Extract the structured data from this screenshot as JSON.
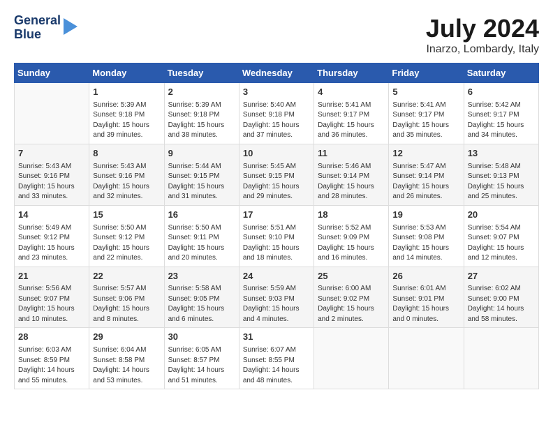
{
  "logo": {
    "line1": "General",
    "line2": "Blue"
  },
  "title": "July 2024",
  "subtitle": "Inarzo, Lombardy, Italy",
  "weekdays": [
    "Sunday",
    "Monday",
    "Tuesday",
    "Wednesday",
    "Thursday",
    "Friday",
    "Saturday"
  ],
  "weeks": [
    [
      {
        "day": "",
        "info": ""
      },
      {
        "day": "1",
        "info": "Sunrise: 5:39 AM\nSunset: 9:18 PM\nDaylight: 15 hours\nand 39 minutes."
      },
      {
        "day": "2",
        "info": "Sunrise: 5:39 AM\nSunset: 9:18 PM\nDaylight: 15 hours\nand 38 minutes."
      },
      {
        "day": "3",
        "info": "Sunrise: 5:40 AM\nSunset: 9:18 PM\nDaylight: 15 hours\nand 37 minutes."
      },
      {
        "day": "4",
        "info": "Sunrise: 5:41 AM\nSunset: 9:17 PM\nDaylight: 15 hours\nand 36 minutes."
      },
      {
        "day": "5",
        "info": "Sunrise: 5:41 AM\nSunset: 9:17 PM\nDaylight: 15 hours\nand 35 minutes."
      },
      {
        "day": "6",
        "info": "Sunrise: 5:42 AM\nSunset: 9:17 PM\nDaylight: 15 hours\nand 34 minutes."
      }
    ],
    [
      {
        "day": "7",
        "info": "Sunrise: 5:43 AM\nSunset: 9:16 PM\nDaylight: 15 hours\nand 33 minutes."
      },
      {
        "day": "8",
        "info": "Sunrise: 5:43 AM\nSunset: 9:16 PM\nDaylight: 15 hours\nand 32 minutes."
      },
      {
        "day": "9",
        "info": "Sunrise: 5:44 AM\nSunset: 9:15 PM\nDaylight: 15 hours\nand 31 minutes."
      },
      {
        "day": "10",
        "info": "Sunrise: 5:45 AM\nSunset: 9:15 PM\nDaylight: 15 hours\nand 29 minutes."
      },
      {
        "day": "11",
        "info": "Sunrise: 5:46 AM\nSunset: 9:14 PM\nDaylight: 15 hours\nand 28 minutes."
      },
      {
        "day": "12",
        "info": "Sunrise: 5:47 AM\nSunset: 9:14 PM\nDaylight: 15 hours\nand 26 minutes."
      },
      {
        "day": "13",
        "info": "Sunrise: 5:48 AM\nSunset: 9:13 PM\nDaylight: 15 hours\nand 25 minutes."
      }
    ],
    [
      {
        "day": "14",
        "info": "Sunrise: 5:49 AM\nSunset: 9:12 PM\nDaylight: 15 hours\nand 23 minutes."
      },
      {
        "day": "15",
        "info": "Sunrise: 5:50 AM\nSunset: 9:12 PM\nDaylight: 15 hours\nand 22 minutes."
      },
      {
        "day": "16",
        "info": "Sunrise: 5:50 AM\nSunset: 9:11 PM\nDaylight: 15 hours\nand 20 minutes."
      },
      {
        "day": "17",
        "info": "Sunrise: 5:51 AM\nSunset: 9:10 PM\nDaylight: 15 hours\nand 18 minutes."
      },
      {
        "day": "18",
        "info": "Sunrise: 5:52 AM\nSunset: 9:09 PM\nDaylight: 15 hours\nand 16 minutes."
      },
      {
        "day": "19",
        "info": "Sunrise: 5:53 AM\nSunset: 9:08 PM\nDaylight: 15 hours\nand 14 minutes."
      },
      {
        "day": "20",
        "info": "Sunrise: 5:54 AM\nSunset: 9:07 PM\nDaylight: 15 hours\nand 12 minutes."
      }
    ],
    [
      {
        "day": "21",
        "info": "Sunrise: 5:56 AM\nSunset: 9:07 PM\nDaylight: 15 hours\nand 10 minutes."
      },
      {
        "day": "22",
        "info": "Sunrise: 5:57 AM\nSunset: 9:06 PM\nDaylight: 15 hours\nand 8 minutes."
      },
      {
        "day": "23",
        "info": "Sunrise: 5:58 AM\nSunset: 9:05 PM\nDaylight: 15 hours\nand 6 minutes."
      },
      {
        "day": "24",
        "info": "Sunrise: 5:59 AM\nSunset: 9:03 PM\nDaylight: 15 hours\nand 4 minutes."
      },
      {
        "day": "25",
        "info": "Sunrise: 6:00 AM\nSunset: 9:02 PM\nDaylight: 15 hours\nand 2 minutes."
      },
      {
        "day": "26",
        "info": "Sunrise: 6:01 AM\nSunset: 9:01 PM\nDaylight: 15 hours\nand 0 minutes."
      },
      {
        "day": "27",
        "info": "Sunrise: 6:02 AM\nSunset: 9:00 PM\nDaylight: 14 hours\nand 58 minutes."
      }
    ],
    [
      {
        "day": "28",
        "info": "Sunrise: 6:03 AM\nSunset: 8:59 PM\nDaylight: 14 hours\nand 55 minutes."
      },
      {
        "day": "29",
        "info": "Sunrise: 6:04 AM\nSunset: 8:58 PM\nDaylight: 14 hours\nand 53 minutes."
      },
      {
        "day": "30",
        "info": "Sunrise: 6:05 AM\nSunset: 8:57 PM\nDaylight: 14 hours\nand 51 minutes."
      },
      {
        "day": "31",
        "info": "Sunrise: 6:07 AM\nSunset: 8:55 PM\nDaylight: 14 hours\nand 48 minutes."
      },
      {
        "day": "",
        "info": ""
      },
      {
        "day": "",
        "info": ""
      },
      {
        "day": "",
        "info": ""
      }
    ]
  ]
}
